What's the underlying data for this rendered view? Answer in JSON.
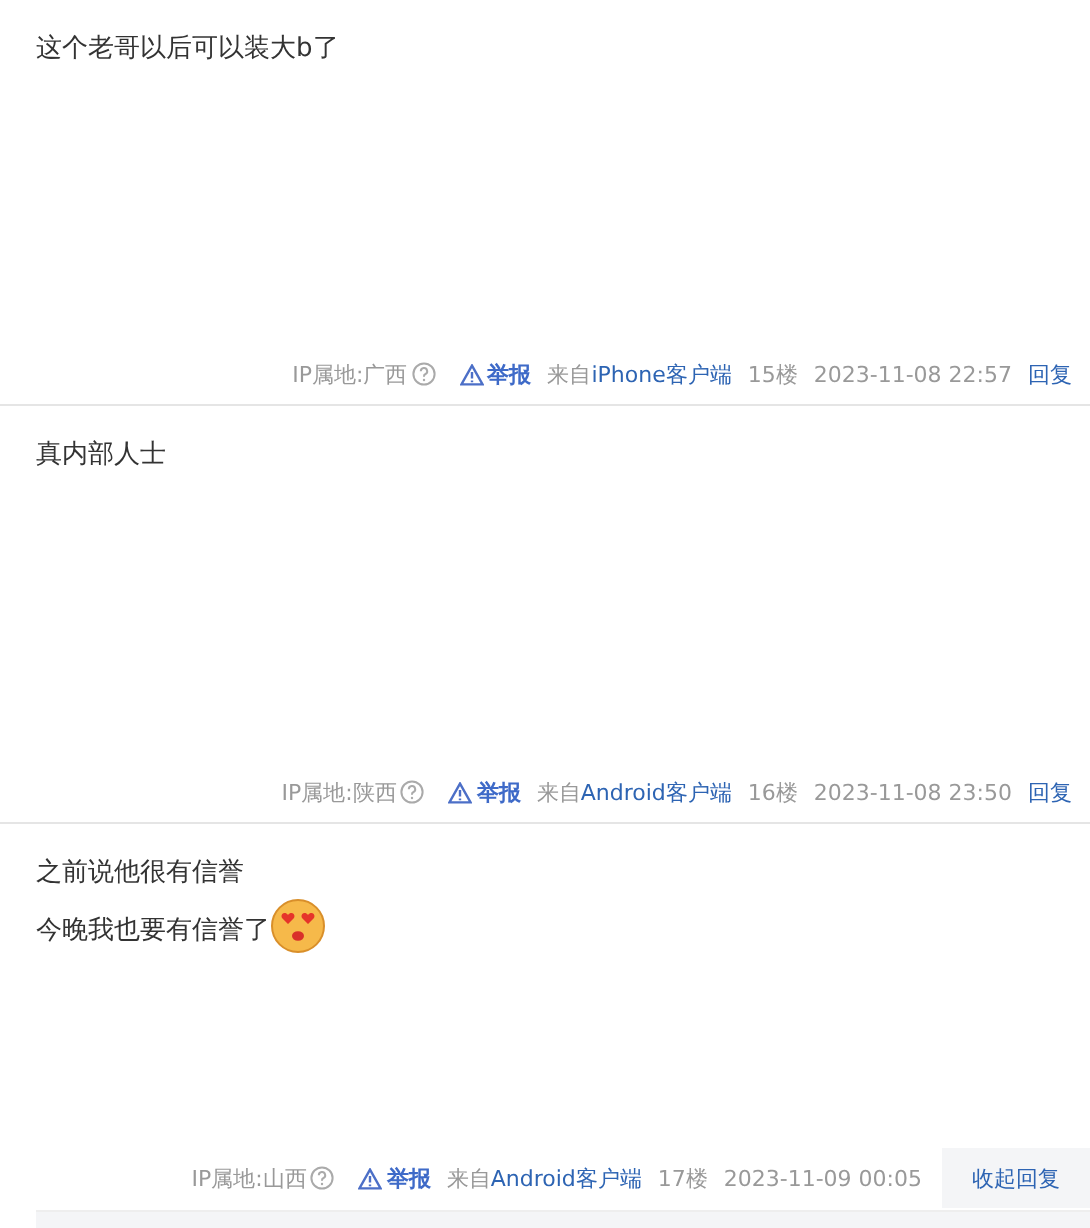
{
  "posts": [
    {
      "lines": [
        {
          "text": "这个老哥以后可以装大b了",
          "emoji": false
        }
      ],
      "ip_location": "IP属地:广西",
      "report": "举报",
      "source_prefix": "来自",
      "source": "iPhone客户端",
      "floor": "15楼",
      "time": "2023-11-08 22:57",
      "reply": {
        "label": "回复",
        "expanded": false
      }
    },
    {
      "lines": [
        {
          "text": "真内部人士",
          "emoji": false
        }
      ],
      "ip_location": "IP属地:陕西",
      "report": "举报",
      "source_prefix": "来自",
      "source": "Android客户端",
      "floor": "16楼",
      "time": "2023-11-08 23:50",
      "reply": {
        "label": "回复",
        "expanded": false
      }
    },
    {
      "lines": [
        {
          "text": "之前说他很有信誉",
          "emoji": false
        },
        {
          "text": "今晚我也要有信誉了",
          "emoji": true
        }
      ],
      "ip_location": "IP属地:山西",
      "report": "举报",
      "source_prefix": "来自",
      "source": "Android客户端",
      "floor": "17楼",
      "time": "2023-11-09 00:05",
      "reply": {
        "label": "收起回复",
        "expanded": true
      }
    }
  ]
}
